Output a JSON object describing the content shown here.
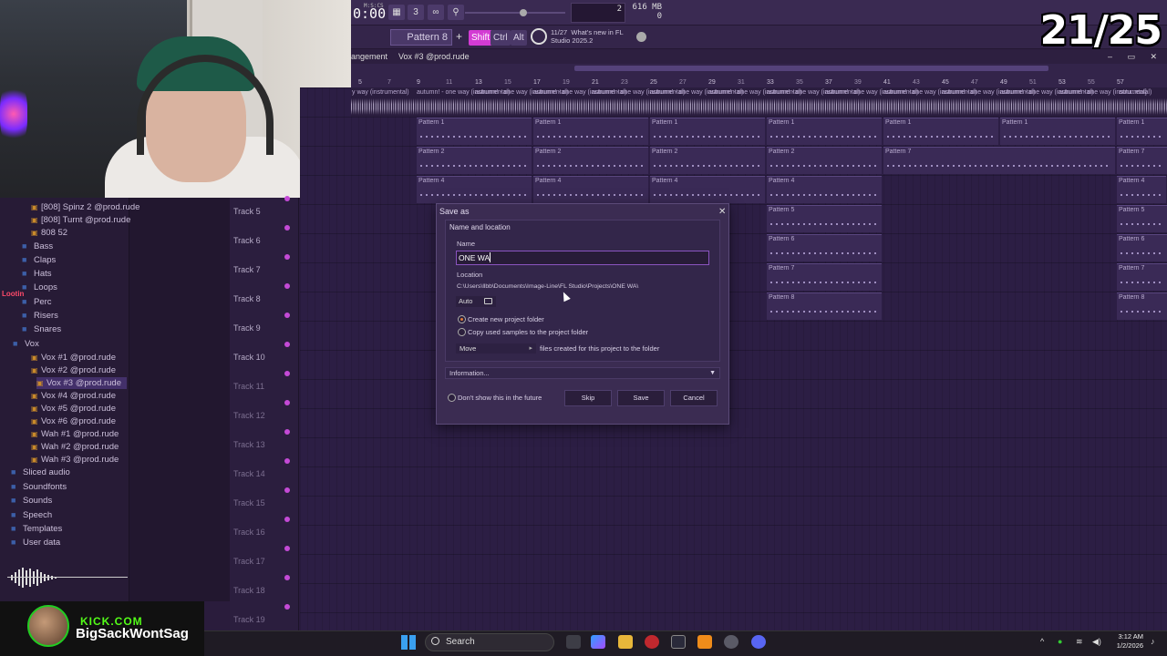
{
  "overlay": {
    "counter": "21/25"
  },
  "toolbar": {
    "timecode": "0:00",
    "timecode_small": "M:S:CS",
    "cpu_value": "2",
    "mem_value": "616 MB",
    "mem_value2": "0",
    "pattern_label": "Pattern 8",
    "keys": {
      "shift": "Shift",
      "ctrl": "Ctrl",
      "alt": "Alt"
    },
    "news_count": "11/27",
    "news_line1": "What's new in FL",
    "news_line2": "Studio 2025.2"
  },
  "playlist": {
    "title_prefix": "angement",
    "title_pattern": "Vox #3 @prod.rude",
    "window_controls": "– ▭ ✕",
    "ruler_ticks": [
      "5",
      "9",
      "13",
      "17",
      "21",
      "25",
      "29",
      "33",
      "37",
      "41",
      "45",
      "49",
      "53",
      "57"
    ],
    "ruler_ticks_small": [
      "7",
      "11",
      "15",
      "19",
      "23",
      "27",
      "31",
      "35",
      "39",
      "43",
      "47",
      "51",
      "55"
    ],
    "audio_clip_label": "autumn! - one way (instrumental)",
    "audio_clip_label_first": "y way (instrumental)",
    "audio_clip_label_last": "autu..ntal]",
    "pattern_labels": [
      "Pattern 1",
      "Pattern 2",
      "Pattern 4",
      "Pattern 5",
      "Pattern 6",
      "Pattern 7",
      "Pattern 8"
    ],
    "tracks": [
      "Track 5",
      "Track 6",
      "Track 7",
      "Track 8",
      "Track 9",
      "Track 10",
      "Track 11",
      "Track 12",
      "Track 13",
      "Track 14",
      "Track 15",
      "Track 16",
      "Track 17",
      "Track 18",
      "Track 19"
    ]
  },
  "browser": {
    "items": [
      {
        "label": "[808] Spinz 2 @prod.rude",
        "kind": "file"
      },
      {
        "label": "[808] Turnt @prod.rude",
        "kind": "file"
      },
      {
        "label": "808 52",
        "kind": "file"
      },
      {
        "label": "Bass",
        "kind": "folder"
      },
      {
        "label": "Claps",
        "kind": "folder"
      },
      {
        "label": "Hats",
        "kind": "folder"
      },
      {
        "label": "Loops",
        "kind": "folder"
      },
      {
        "label": "Perc",
        "kind": "folder"
      },
      {
        "label": "Risers",
        "kind": "folder"
      },
      {
        "label": "Snares",
        "kind": "folder"
      },
      {
        "label": "Vox",
        "kind": "folder"
      },
      {
        "label": "Vox #1 @prod.rude",
        "kind": "file"
      },
      {
        "label": "Vox #2 @prod.rude",
        "kind": "file"
      },
      {
        "label": "Vox #3 @prod.rude",
        "kind": "file"
      },
      {
        "label": "Vox #4 @prod.rude",
        "kind": "file"
      },
      {
        "label": "Vox #5 @prod.rude",
        "kind": "file"
      },
      {
        "label": "Vox #6 @prod.rude",
        "kind": "file"
      },
      {
        "label": "Wah #1 @prod.rude",
        "kind": "file"
      },
      {
        "label": "Wah #2 @prod.rude",
        "kind": "file"
      },
      {
        "label": "Wah #3 @prod.rude",
        "kind": "file"
      },
      {
        "label": "Sliced audio",
        "kind": "folder"
      },
      {
        "label": "Soundfonts",
        "kind": "folder"
      },
      {
        "label": "Sounds",
        "kind": "folder"
      },
      {
        "label": "Speech",
        "kind": "folder"
      },
      {
        "label": "Templates",
        "kind": "folder"
      },
      {
        "label": "User data",
        "kind": "folder"
      }
    ],
    "overlay_tag": "Lootin"
  },
  "stream": {
    "site": "KICK.COM",
    "name": "BigSackWontSag"
  },
  "dialog": {
    "title": "Save as",
    "section": "Name and location",
    "name_label": "Name",
    "name_value": "ONE WA",
    "location_label": "Location",
    "location_path": "C:\\Users\\llbb\\Documents\\Image-Line\\FL Studio\\Projects\\ONE WA\\",
    "auto_label": "Auto",
    "opt_create_folder": "Create new project folder",
    "opt_copy_samples": "Copy used samples to the project folder",
    "move_label": "Move",
    "move_suffix": "files created for this project to the folder",
    "information": "Information...",
    "dont_show": "Don't show this in the future",
    "skip": "Skip",
    "save": "Save",
    "cancel": "Cancel"
  },
  "taskbar": {
    "search_label": "Search",
    "time": "3:12 AM",
    "date": "1/2/2026"
  }
}
